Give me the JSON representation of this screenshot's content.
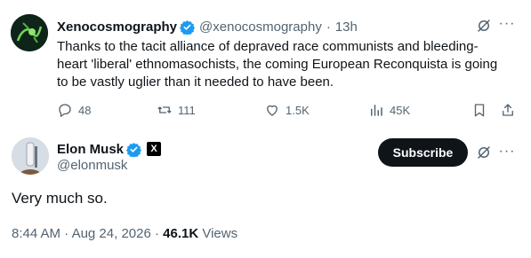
{
  "quoted_post": {
    "author_name": "Xenocosmography",
    "author_handle": "@xenocosmography",
    "separator": "·",
    "time": "13h",
    "text": "Thanks to the tacit alliance of depraved race communists and bleeding-heart 'liberal' ethnomasochists, the coming European Reconquista is going to be vastly uglier than it needed to have been.",
    "more_label": "···",
    "actions": {
      "replies": "48",
      "reposts": "111",
      "likes": "1.5K",
      "views": "45K"
    }
  },
  "main_post": {
    "author_name": "Elon Musk",
    "author_handle": "@elonmusk",
    "subscribe_label": "Subscribe",
    "more_label": "···",
    "text": "Very much so.",
    "time": "8:44 AM",
    "date": "Aug 24, 2026",
    "separator": "·",
    "views_count": "46.1K",
    "views_label": "Views"
  },
  "icons": {
    "verified": "verified-badge-icon",
    "affiliate": "x-affiliate-badge-icon",
    "grok": "grok-icon",
    "reply": "reply-icon",
    "repost": "repost-icon",
    "like": "like-icon",
    "views": "views-icon",
    "bookmark": "bookmark-icon",
    "share": "share-icon"
  },
  "colors": {
    "verified_blue": "#1d9bf0",
    "secondary_text": "#536471",
    "primary_text": "#0f1419",
    "subscribe_bg": "#0f1419"
  }
}
